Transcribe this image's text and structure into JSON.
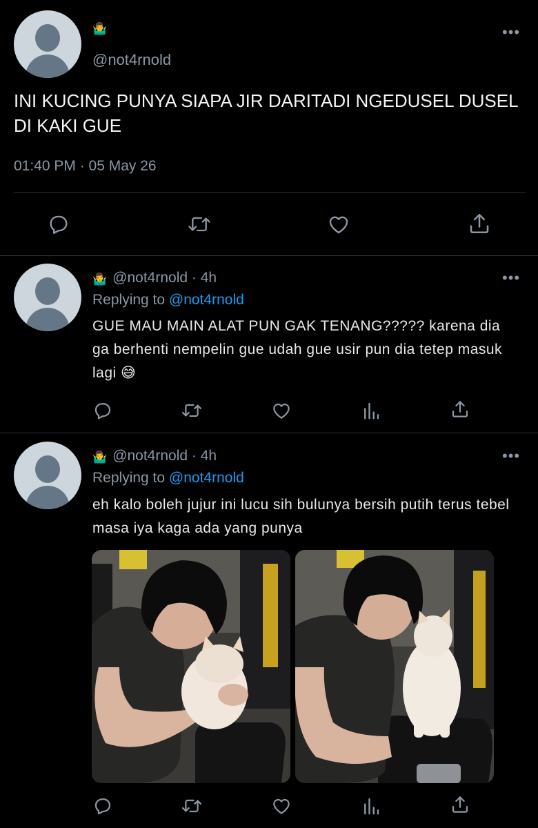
{
  "main_tweet": {
    "emoji": "🤷‍♂️",
    "handle": "@not4rnold",
    "text": "INI KUCING PUNYA SIAPA JIR DARITADI NGEDUSEL DUSEL DI KAKI GUE",
    "timestamp": "01:40 PM · 05 May 26",
    "more": "•••"
  },
  "replies": [
    {
      "emoji": "🤷‍♂️",
      "handle_time": "@not4rnold · 4h",
      "replying_label": "Replying to",
      "replying_handle": "@not4rnold",
      "text": "GUE MAU MAIN ALAT PUN GAK TENANG????? karena dia ga berhenti nempelin gue udah gue usir pun dia tetep masuk lagi 😅",
      "more": "•••"
    },
    {
      "emoji": "🤷‍♂️",
      "handle_time": "@not4rnold · 4h",
      "replying_label": "Replying to",
      "replying_handle": "@not4rnold",
      "text": "eh kalo boleh jujur ini lucu sih bulunya bersih putih terus tebel masa iya kaga ada yang punya",
      "more": "•••"
    }
  ],
  "icons": {
    "reply": "reply-icon",
    "retweet": "retweet-icon",
    "like": "heart-icon",
    "analytics": "analytics-icon",
    "share": "share-icon"
  },
  "colors": {
    "background": "#000000",
    "text": "#e7e9ea",
    "muted": "#8b98a5",
    "link": "#1d9bf0",
    "divider": "#2f3336"
  }
}
